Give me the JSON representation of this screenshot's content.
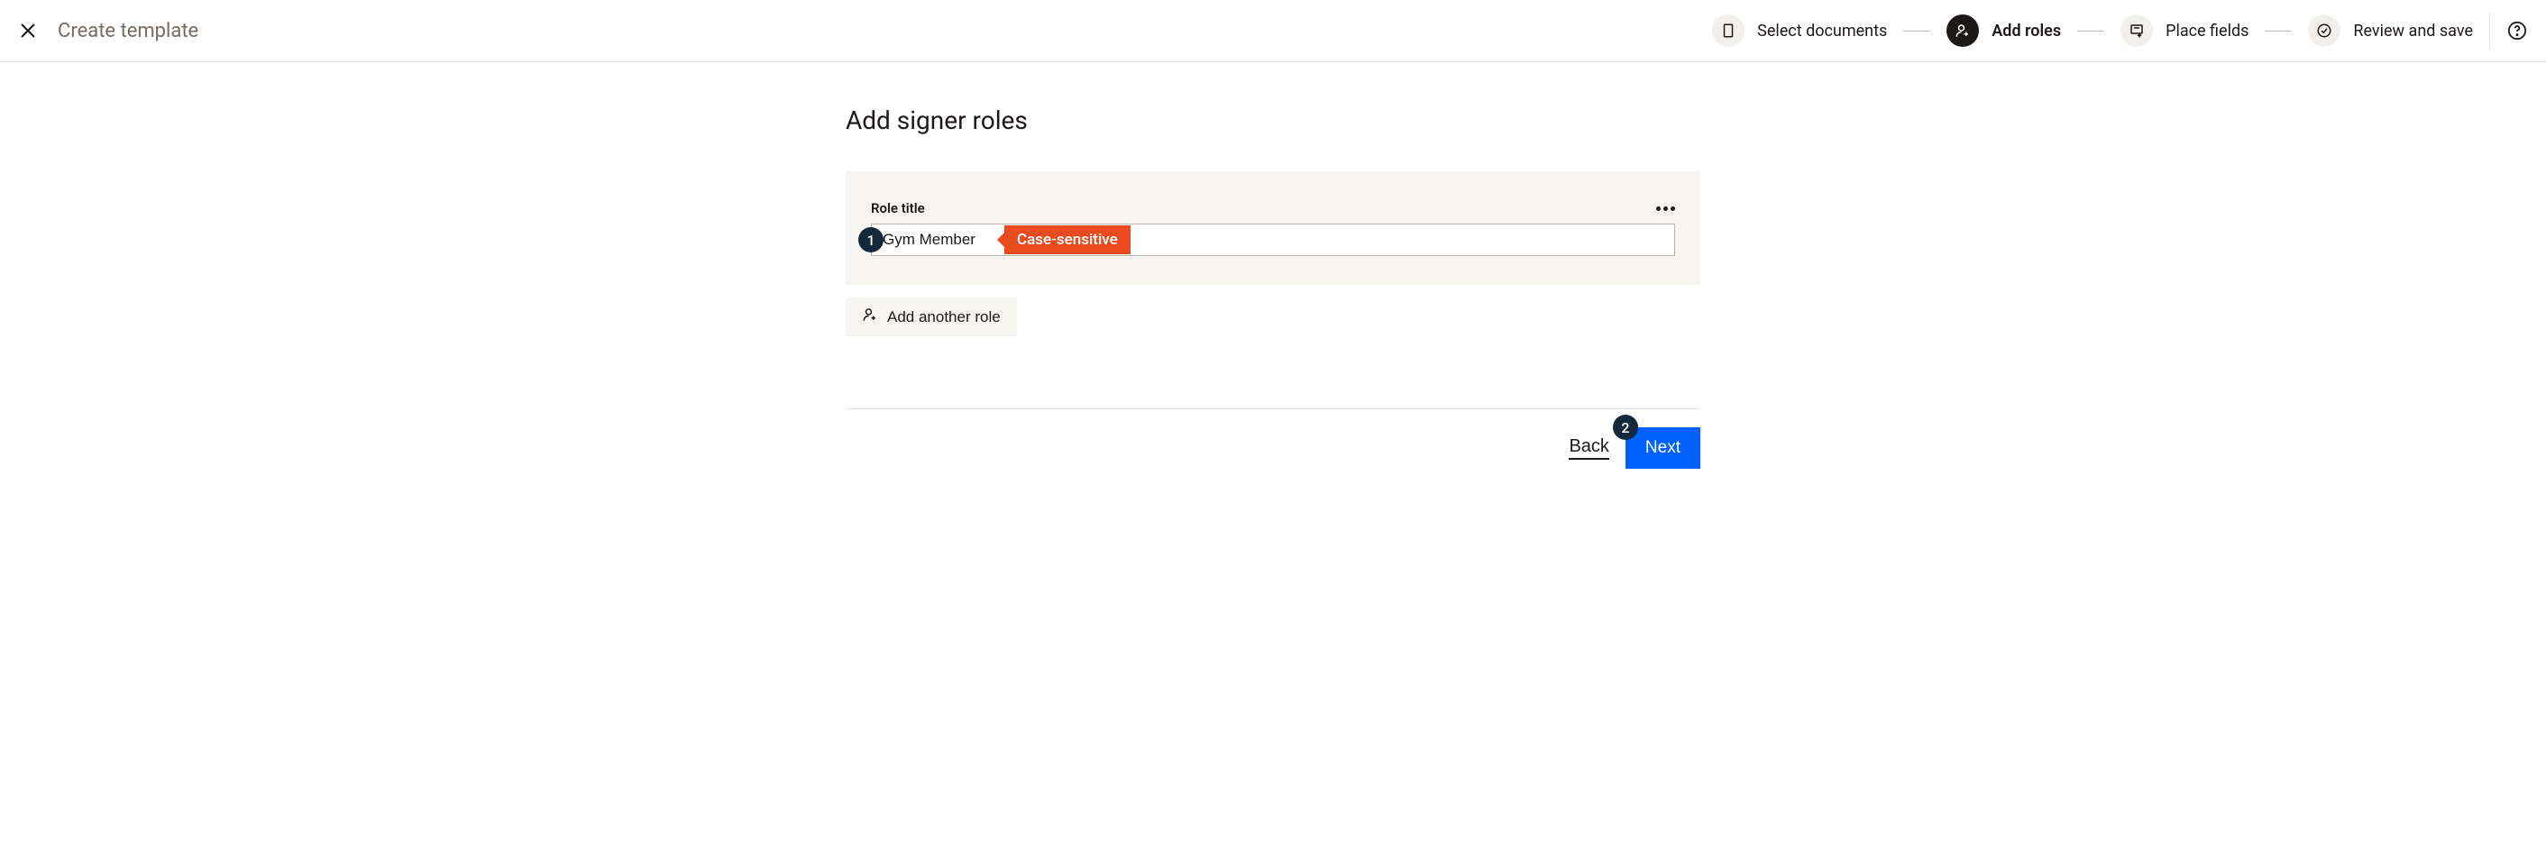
{
  "header": {
    "title": "Create template",
    "steps": [
      {
        "label": "Select documents",
        "icon": "document-icon",
        "active": false
      },
      {
        "label": "Add roles",
        "icon": "person-add-icon",
        "active": true
      },
      {
        "label": "Place fields",
        "icon": "field-icon",
        "active": false
      },
      {
        "label": "Review and save",
        "icon": "check-circle-icon",
        "active": false
      }
    ]
  },
  "page": {
    "title": "Add signer roles"
  },
  "role": {
    "label": "Role title",
    "value": "Gym Member",
    "tooltip": "Case-sensitive"
  },
  "addRole": {
    "label": "Add another role"
  },
  "footer": {
    "back": "Back",
    "next": "Next"
  },
  "annotations": {
    "badge1": "1",
    "badge2": "2"
  }
}
